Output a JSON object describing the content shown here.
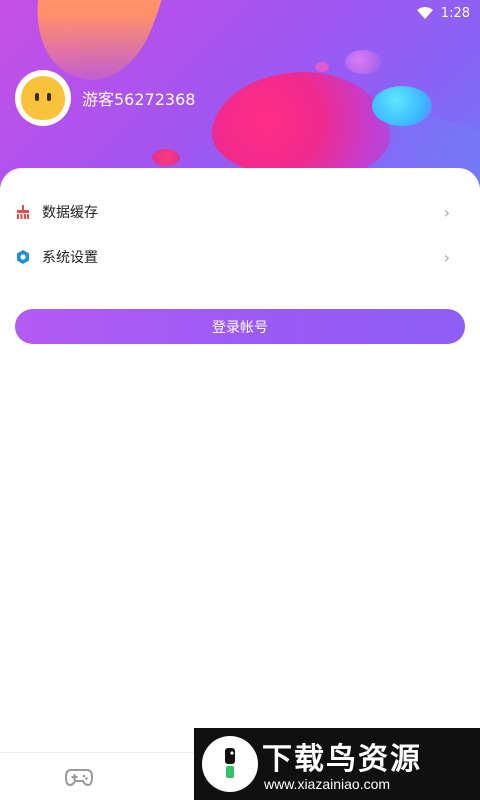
{
  "status_bar": {
    "time": "1:28",
    "icons": [
      "wifi-icon"
    ]
  },
  "profile": {
    "username": "游客56272368",
    "avatar_icon": "ghost-avatar-icon"
  },
  "menu": {
    "items": [
      {
        "label": "数据缓存",
        "icon": "broom-icon",
        "icon_color": "#e94b4b"
      },
      {
        "label": "系统设置",
        "icon": "gear-hexagon-icon",
        "icon_color": "#1f8fd6"
      }
    ]
  },
  "login_button": {
    "label": "登录帐号"
  },
  "bottom_nav": {
    "items": [
      {
        "icon": "gamepad-icon"
      }
    ]
  },
  "watermark": {
    "title": "下载鸟资源",
    "url": "www.xiazainiao.com"
  },
  "colors": {
    "accent": "#9b5bf5",
    "header_start": "#c64fe6",
    "header_end": "#6f78f3"
  }
}
